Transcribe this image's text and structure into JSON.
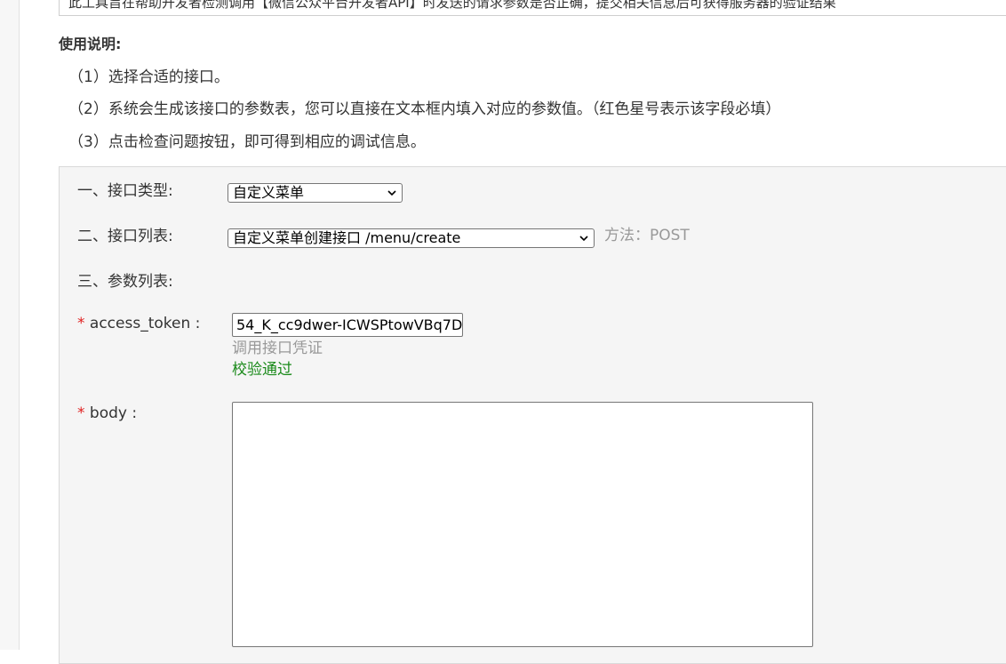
{
  "intro": {
    "text": "此工具旨在帮助开发者检测调用【微信公众平台开发者API】时发送的请求参数是否正确，提交相关信息后可获得服务器的验证结果"
  },
  "usage": {
    "title": "使用说明:",
    "steps": [
      "（1）选择合适的接口。",
      "（2）系统会生成该接口的参数表，您可以直接在文本框内填入对应的参数值。（红色星号表示该字段必填）",
      "（3）点击检查问题按钮，即可得到相应的调试信息。"
    ]
  },
  "form": {
    "api_type_label": "一、接口类型:",
    "api_type_value": "自定义菜单",
    "api_list_label": "二、接口列表:",
    "api_list_value": "自定义菜单创建接口 /menu/create",
    "method_text": "方法：POST",
    "params_label": "三、参数列表:",
    "required_mark": "*",
    "access_token": {
      "label": "access_token :",
      "value": "54_K_cc9dwer-ICWSPtowVBq7D",
      "hint": "调用接口凭证",
      "status": "校验通过"
    },
    "body": {
      "label": "body :",
      "value": ""
    }
  },
  "colors": {
    "required": "#e02020",
    "valid": "#1a8a1a",
    "hint": "#999999",
    "panel_bg": "#f5f5f5"
  }
}
